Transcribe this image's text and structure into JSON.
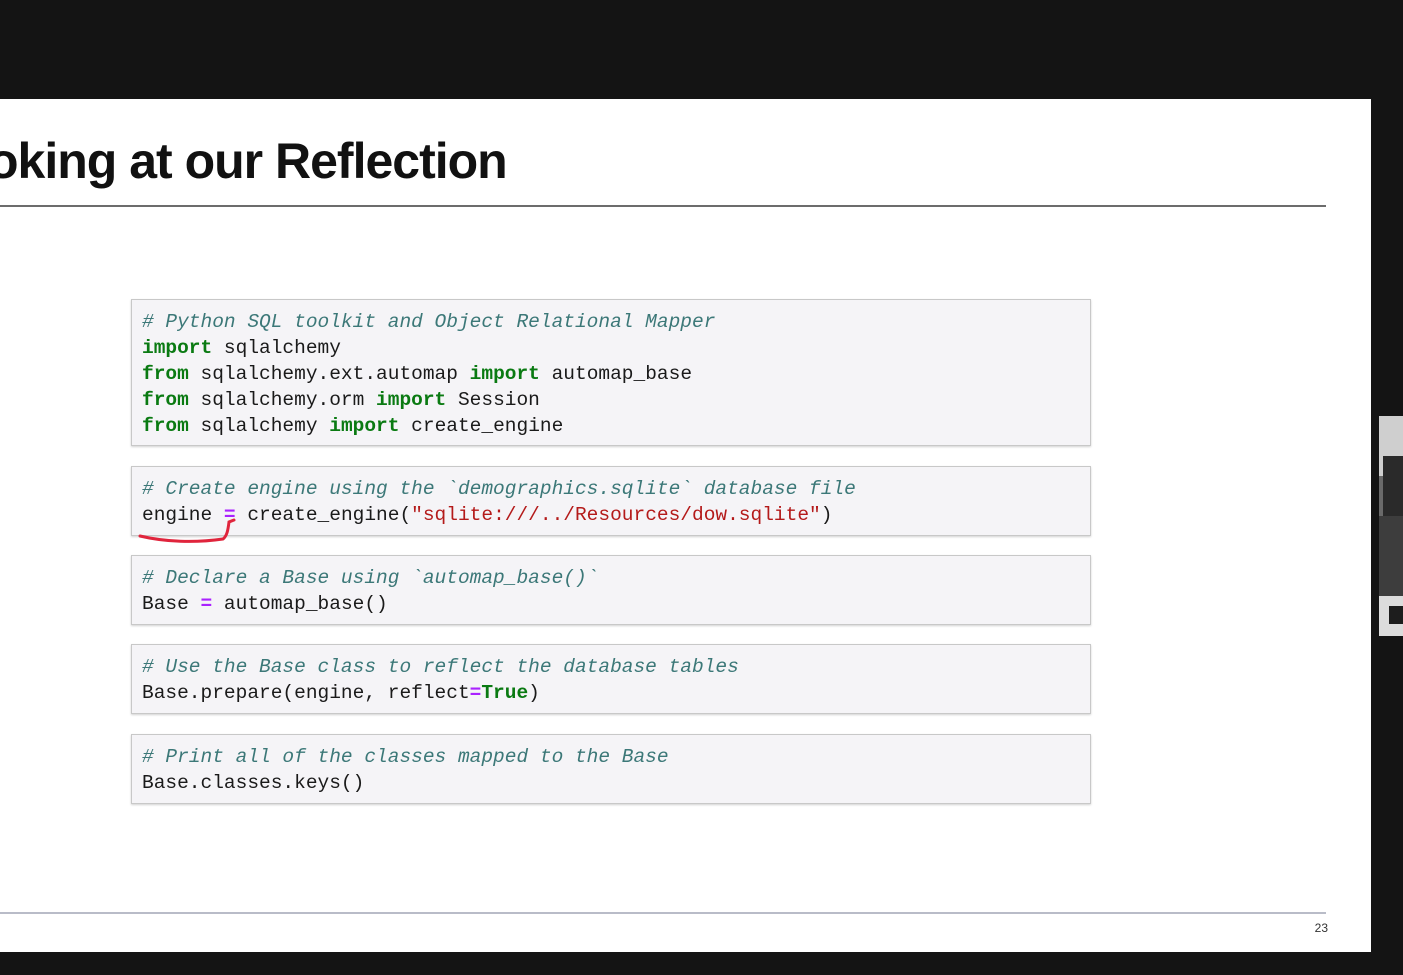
{
  "slide": {
    "title": "oking at our Reflection",
    "page_number": "23"
  },
  "cells": [
    {
      "lines": [
        [
          {
            "t": "cm",
            "text": "# Python SQL toolkit and Object Relational Mapper"
          }
        ],
        [
          {
            "t": "kw",
            "text": "import"
          },
          {
            "t": "pl",
            "text": " sqlalchemy"
          }
        ],
        [
          {
            "t": "kw",
            "text": "from"
          },
          {
            "t": "pl",
            "text": " sqlalchemy.ext.automap "
          },
          {
            "t": "kw",
            "text": "import"
          },
          {
            "t": "pl",
            "text": " automap_base"
          }
        ],
        [
          {
            "t": "kw",
            "text": "from"
          },
          {
            "t": "pl",
            "text": " sqlalchemy.orm "
          },
          {
            "t": "kw",
            "text": "import"
          },
          {
            "t": "pl",
            "text": " Session"
          }
        ],
        [
          {
            "t": "kw",
            "text": "from"
          },
          {
            "t": "pl",
            "text": " sqlalchemy "
          },
          {
            "t": "kw",
            "text": "import"
          },
          {
            "t": "pl",
            "text": " create_engine"
          }
        ]
      ]
    },
    {
      "lines": [
        [
          {
            "t": "cm",
            "text": "# Create engine using the `demographics.sqlite` database file"
          }
        ],
        [
          {
            "t": "pl",
            "text": "engine "
          },
          {
            "t": "op",
            "text": "="
          },
          {
            "t": "pl",
            "text": " create_engine("
          },
          {
            "t": "str",
            "text": "\"sqlite:///../Resources/dow.sqlite\""
          },
          {
            "t": "pl",
            "text": ")"
          }
        ]
      ]
    },
    {
      "lines": [
        [
          {
            "t": "cm",
            "text": "# Declare a Base using `automap_base()`"
          }
        ],
        [
          {
            "t": "pl",
            "text": "Base "
          },
          {
            "t": "op",
            "text": "="
          },
          {
            "t": "pl",
            "text": " automap_base()"
          }
        ]
      ]
    },
    {
      "lines": [
        [
          {
            "t": "cm",
            "text": "# Use the Base class to reflect the database tables"
          }
        ],
        [
          {
            "t": "pl",
            "text": "Base.prepare(engine, reflect"
          },
          {
            "t": "op",
            "text": "="
          },
          {
            "t": "kw",
            "text": "True"
          },
          {
            "t": "pl",
            "text": ")"
          }
        ]
      ]
    },
    {
      "lines": [
        [
          {
            "t": "cm",
            "text": "# Print all of the classes mapped to the Base"
          }
        ],
        [
          {
            "t": "pl",
            "text": "Base.classes.keys()"
          }
        ]
      ]
    }
  ],
  "colors": {
    "comment": "#3c7878",
    "keyword": "#0a7a12",
    "operator": "#aa22ff",
    "string": "#b41a1a",
    "annotation_pen": "#e0243c"
  },
  "icons": [
    "pen-annotation-mark"
  ]
}
